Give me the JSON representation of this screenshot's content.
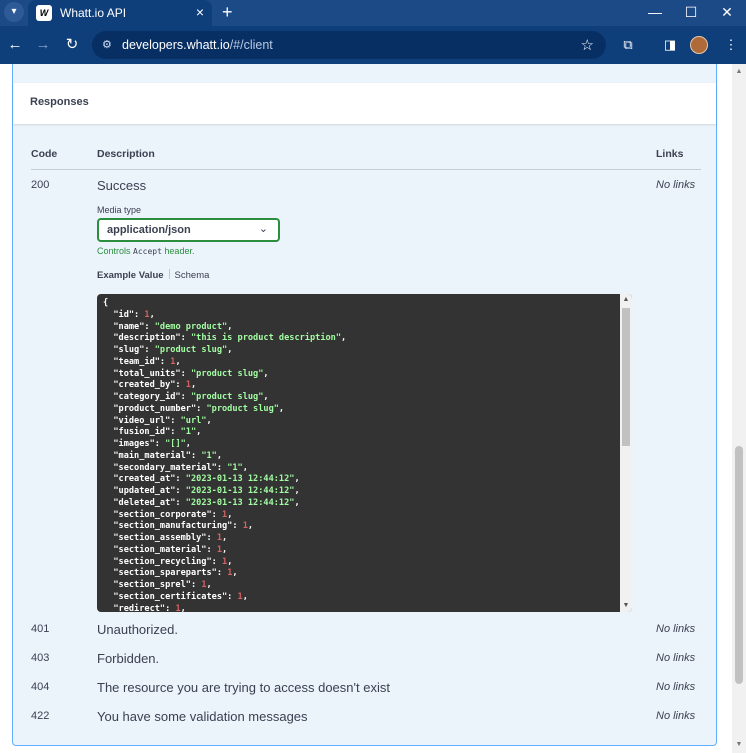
{
  "browser": {
    "tab_title": "Whatt.io API",
    "tab_favicon": "W",
    "new_tab": "+",
    "url_host": "developers.whatt.io",
    "url_path": "/#/client"
  },
  "responses": {
    "title": "Responses",
    "headers": {
      "code": "Code",
      "description": "Description",
      "links": "Links"
    },
    "success": {
      "code": "200",
      "description": "Success",
      "links": "No links",
      "media_label": "Media type",
      "media_value": "application/json",
      "hint_prefix": "Controls ",
      "hint_code": "Accept",
      "hint_suffix": " header.",
      "tab_example": "Example Value",
      "tab_schema": "Schema"
    },
    "others": [
      {
        "code": "401",
        "description": "Unauthorized.",
        "links": "No links"
      },
      {
        "code": "403",
        "description": "Forbidden.",
        "links": "No links"
      },
      {
        "code": "404",
        "description": "The resource you are trying to access doesn't exist",
        "links": "No links"
      },
      {
        "code": "422",
        "description": "You have some validation messages",
        "links": "No links"
      }
    ]
  },
  "example_json": [
    {
      "k": null,
      "v": "{",
      "t": "brace"
    },
    {
      "k": "id",
      "v": "1",
      "t": "num"
    },
    {
      "k": "name",
      "v": "\"demo product\"",
      "t": "str"
    },
    {
      "k": "description",
      "v": "\"this is product description\"",
      "t": "str"
    },
    {
      "k": "slug",
      "v": "\"product slug\"",
      "t": "str"
    },
    {
      "k": "team_id",
      "v": "1",
      "t": "num"
    },
    {
      "k": "total_units",
      "v": "\"product slug\"",
      "t": "str"
    },
    {
      "k": "created_by",
      "v": "1",
      "t": "num"
    },
    {
      "k": "category_id",
      "v": "\"product slug\"",
      "t": "str"
    },
    {
      "k": "product_number",
      "v": "\"product slug\"",
      "t": "str"
    },
    {
      "k": "video_url",
      "v": "\"url\"",
      "t": "str"
    },
    {
      "k": "fusion_id",
      "v": "\"1\"",
      "t": "str"
    },
    {
      "k": "images",
      "v": "\"[]\"",
      "t": "str"
    },
    {
      "k": "main_material",
      "v": "\"1\"",
      "t": "str"
    },
    {
      "k": "secondary_material",
      "v": "\"1\"",
      "t": "str"
    },
    {
      "k": "created_at",
      "v": "\"2023-01-13 12:44:12\"",
      "t": "str"
    },
    {
      "k": "updated_at",
      "v": "\"2023-01-13 12:44:12\"",
      "t": "str"
    },
    {
      "k": "deleted_at",
      "v": "\"2023-01-13 12:44:12\"",
      "t": "str"
    },
    {
      "k": "section_corporate",
      "v": "1",
      "t": "num"
    },
    {
      "k": "section_manufacturing",
      "v": "1",
      "t": "num"
    },
    {
      "k": "section_assembly",
      "v": "1",
      "t": "num"
    },
    {
      "k": "section_material",
      "v": "1",
      "t": "num"
    },
    {
      "k": "section_recycling",
      "v": "1",
      "t": "num"
    },
    {
      "k": "section_spareparts",
      "v": "1",
      "t": "num"
    },
    {
      "k": "section_sprel",
      "v": "1",
      "t": "num"
    },
    {
      "k": "section_certificates",
      "v": "1",
      "t": "num"
    },
    {
      "k": "redirect",
      "v": "1",
      "t": "num"
    }
  ],
  "colors": {
    "accent": "#61affe",
    "success": "#2a8e3d",
    "code_bg": "#333333",
    "chrome": "#0f3f7a"
  }
}
